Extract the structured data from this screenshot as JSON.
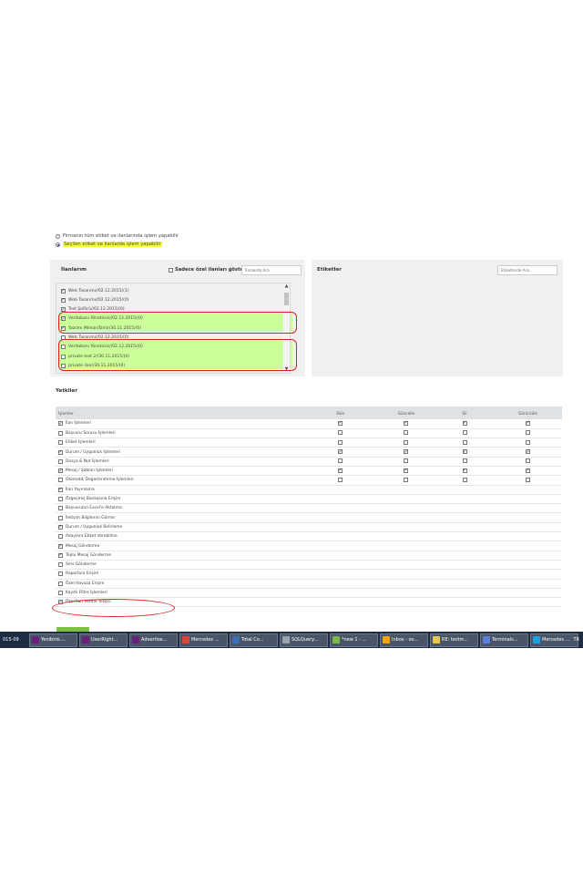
{
  "scope": {
    "option_all_label": "Firmanın tüm etiket ve ilanlarında işlem yapabilir",
    "option_selected_label": "Seçilen etiket ve ilanlarda işlem yapabilir",
    "selected": "selected"
  },
  "ilanlarim": {
    "title": "İlanlarım",
    "only_private_label": "Sadece özel ilanları göster",
    "search_placeholder": "İlanlarda Ara",
    "items": [
      {
        "label": "Web Tasarımı//02.12.2015/(1)",
        "checked": true,
        "highlight": false
      },
      {
        "label": "Web Tasarımı//02.12.2015/(0)",
        "checked": true,
        "highlight": false
      },
      {
        "label": "Test Şoförü//02.12.2015/(0)",
        "checked": true,
        "highlight": false
      },
      {
        "label": "Veritabanı Yöneticisi//02.12.2015/(0)",
        "checked": true,
        "highlight": true
      },
      {
        "label": "Yazılım Mimarı/İzmir/30.11.2015/(0)",
        "checked": true,
        "highlight": true
      },
      {
        "label": "Web Tasarımı//02.12.2015/(0)",
        "checked": false,
        "highlight": false
      },
      {
        "label": "Veritabanı Yöneticisi//02.12.2015/(0)",
        "checked": false,
        "highlight": true
      },
      {
        "label": "private test 2//30.11.2015/(0)",
        "checked": false,
        "highlight": true
      },
      {
        "label": "private ilan//30.11.2015/(0)",
        "checked": false,
        "highlight": true
      }
    ]
  },
  "etiketler": {
    "title": "Etiketler",
    "search_placeholder": "Etiketlerde Ara"
  },
  "yetkiler": {
    "title": "Yetkiler",
    "columns": [
      "İşlemler",
      "Ekle",
      "Güncelle",
      "Sil",
      "Görüntüle"
    ],
    "rows": [
      {
        "label": "İlan İşlemleri",
        "checked": true,
        "perms": [
          true,
          true,
          true,
          true
        ]
      },
      {
        "label": "Başvuru Sorusu İşlemleri",
        "checked": false,
        "perms": [
          false,
          false,
          false,
          false
        ]
      },
      {
        "label": "Etiket İşlemleri",
        "checked": false,
        "perms": [
          false,
          false,
          false,
          false
        ]
      },
      {
        "label": "Durum / Uygunluk İşlemleri",
        "checked": true,
        "perms": [
          true,
          true,
          true,
          true
        ]
      },
      {
        "label": "Dosya & Not İşlemleri",
        "checked": false,
        "perms": [
          false,
          false,
          false,
          false
        ]
      },
      {
        "label": "Mesaj / Şablon İşlemleri",
        "checked": true,
        "perms": [
          true,
          true,
          true,
          true
        ]
      },
      {
        "label": "Otomatik Değerlendirme İşlemleri",
        "checked": false,
        "perms": [
          false,
          false,
          false,
          false
        ]
      },
      {
        "label": "İlan Yayınlama",
        "checked": true,
        "perms": null
      },
      {
        "label": "Özgeçmiş Bankasına Erişim",
        "checked": false,
        "perms": null
      },
      {
        "label": "Başvuruları Excel'e Aktarma",
        "checked": false,
        "perms": null
      },
      {
        "label": "İletişim Bilgilerini Görme",
        "checked": false,
        "perms": null
      },
      {
        "label": "Durum / Uygunluk Belirleme",
        "checked": true,
        "perms": null
      },
      {
        "label": "Adaylara Etiket Verebilme",
        "checked": false,
        "perms": null
      },
      {
        "label": "Mesaj Gönderme",
        "checked": true,
        "perms": null
      },
      {
        "label": "Toplu Mesaj Gönderme",
        "checked": true,
        "perms": null
      },
      {
        "label": "Sms Gönderme",
        "checked": false,
        "perms": null
      },
      {
        "label": "Raporlara Erişim",
        "checked": false,
        "perms": null
      },
      {
        "label": "Özel Havuza Erişim",
        "checked": false,
        "perms": null
      },
      {
        "label": "Kayıtlı Filtre İşlemleri",
        "checked": false,
        "perms": null
      },
      {
        "label": "Özel İlan Verme Yetkisi",
        "checked": true,
        "perms": null
      }
    ]
  },
  "taskbar": {
    "date_fragment": "015-09",
    "items": [
      {
        "label": "Yenibiris....",
        "icon": "visual-studio-icon",
        "color": "#68217a"
      },
      {
        "label": "UserRight...",
        "icon": "visual-studio-icon",
        "color": "#68217a"
      },
      {
        "label": "Advertise...",
        "icon": "visual-studio-icon",
        "color": "#68217a"
      },
      {
        "label": "Mercedes ...",
        "icon": "chrome-icon",
        "color": "#db4437"
      },
      {
        "label": "Total Co...",
        "icon": "floppy-icon",
        "color": "#3b6fb6"
      },
      {
        "label": "SQLQuery...",
        "icon": "sql-server-icon",
        "color": "#9aa3ad"
      },
      {
        "label": "*new 1 - ...",
        "icon": "notepad-plus-icon",
        "color": "#7ab648"
      },
      {
        "label": "Inbox - os...",
        "icon": "outlook-icon",
        "color": "#f0a30a"
      },
      {
        "label": "RE: testm...",
        "icon": "mail-icon",
        "color": "#e8c84a"
      },
      {
        "label": "Terminals...",
        "icon": "terminals-icon",
        "color": "#5b7fd6"
      },
      {
        "label": "Mercedes ...",
        "icon": "ie-icon",
        "color": "#1ba1e2"
      }
    ],
    "lang": "TR"
  },
  "colors": {
    "highlight_yellow": "#f4ff3a",
    "highlight_green": "#ccff99",
    "annotation_red": "#dd2222",
    "table_header": "#dfe2e5",
    "taskbar": "#1f2d44"
  }
}
